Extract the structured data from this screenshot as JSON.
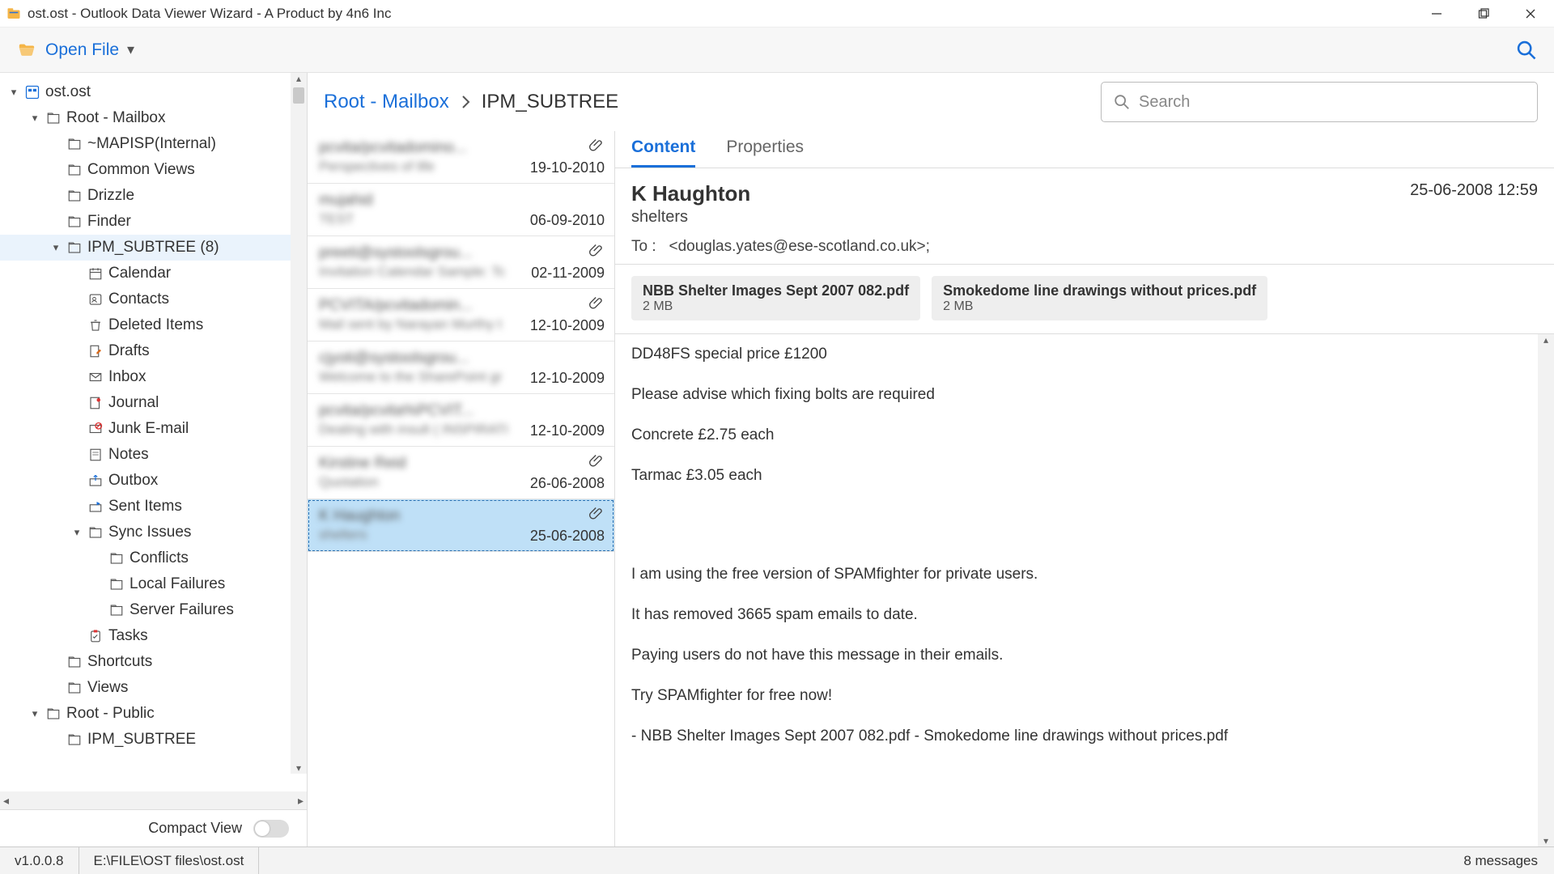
{
  "window": {
    "title": "ost.ost - Outlook Data Viewer Wizard - A Product by 4n6 Inc"
  },
  "toolbar": {
    "open_label": "Open File"
  },
  "tree": {
    "root": "ost.ost",
    "mailbox": "Root - Mailbox",
    "mapisp": "~MAPISP(Internal)",
    "common": "Common Views",
    "drizzle": "Drizzle",
    "finder": "Finder",
    "ipm": "IPM_SUBTREE (8)",
    "calendar": "Calendar",
    "contacts": "Contacts",
    "deleted": "Deleted Items",
    "drafts": "Drafts",
    "inbox": "Inbox",
    "journal": "Journal",
    "junk": "Junk E-mail",
    "notes": "Notes",
    "outbox": "Outbox",
    "sent": "Sent Items",
    "sync": "Sync Issues",
    "conflicts": "Conflicts",
    "localfail": "Local Failures",
    "serverfail": "Server Failures",
    "tasks": "Tasks",
    "shortcuts": "Shortcuts",
    "views": "Views",
    "public": "Root - Public",
    "ipm2": "IPM_SUBTREE"
  },
  "compact": {
    "label": "Compact View"
  },
  "crumbs": {
    "root": "Root - Mailbox",
    "cur": "IPM_SUBTREE"
  },
  "search": {
    "placeholder": "Search"
  },
  "messages": [
    {
      "from": "pcvita/pcvitadomino...",
      "sub": "Perspectives of life",
      "date": "19-10-2010",
      "clip": true
    },
    {
      "from": "mujahid",
      "sub": "TEST",
      "date": "06-09-2010",
      "clip": false
    },
    {
      "from": "preeti@systoolsgrou...",
      "sub": "Invitation Calendar Sample: Tc",
      "date": "02-11-2009",
      "clip": true
    },
    {
      "from": "PCVITA/pcvitadomin...",
      "sub": "Mail sent by Narayan Murthy t",
      "date": "12-10-2009",
      "clip": true
    },
    {
      "from": "cjyoti@systoolsgrou...",
      "sub": "Welcome to the SharePoint gr",
      "date": "12-10-2009",
      "clip": false
    },
    {
      "from": "pcvita/pcvita%PCVIT...",
      "sub": "Dealing with insult ( INSPIRATI",
      "date": "12-10-2009",
      "clip": false
    },
    {
      "from": "Kirstine Reid",
      "sub": "Quotation",
      "date": "26-06-2008",
      "clip": true
    },
    {
      "from": "K Haughton",
      "sub": "shelters",
      "date": "25-06-2008",
      "clip": true
    }
  ],
  "tabs": {
    "content": "Content",
    "props": "Properties"
  },
  "detail": {
    "from": "K Haughton",
    "subject": "shelters",
    "datetime": "25-06-2008 12:59",
    "to_label": "To :",
    "to_value": "<douglas.yates@ese-scotland.co.uk>;",
    "attachments": [
      {
        "name": "NBB Shelter Images Sept 2007 082.pdf",
        "size": "2 MB"
      },
      {
        "name": "Smokedome line drawings without prices.pdf",
        "size": "2 MB"
      }
    ],
    "body": {
      "l1": "DD48FS special price £1200",
      "l2": "Please advise which fixing bolts are required",
      "l3": "Concrete £2.75 each",
      "l4": "Tarmac £3.05 each",
      "l5": "I am using the free version of SPAMfighter for private users.",
      "l6": "It has removed 3665 spam emails to date.",
      "l7": "Paying users do not have this message in their emails.",
      "l8": "Try SPAMfighter for free now!",
      "l9": " - NBB Shelter Images Sept 2007 082.pdf - Smokedome line drawings without prices.pdf"
    }
  },
  "status": {
    "version": "v1.0.0.8",
    "path": "E:\\FILE\\OST files\\ost.ost",
    "count": "8  messages"
  }
}
